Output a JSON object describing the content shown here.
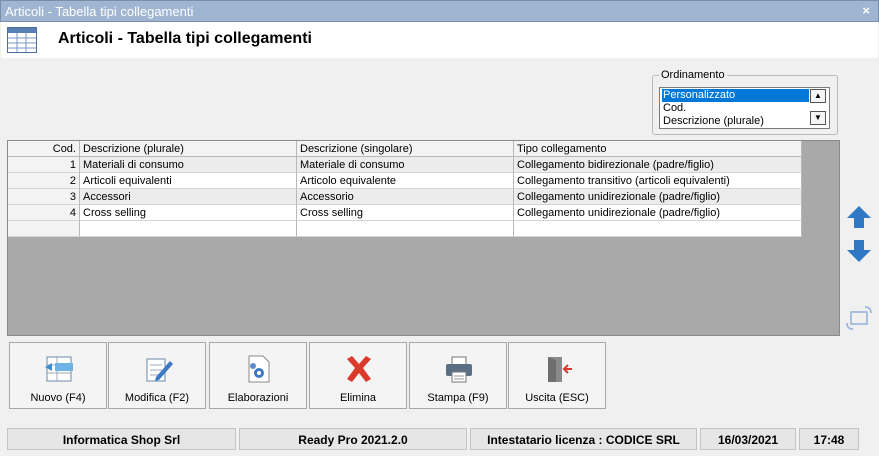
{
  "window": {
    "title": "Articoli - Tabella tipi collegamenti",
    "close_glyph": "×"
  },
  "header": {
    "title": "Articoli - Tabella tipi collegamenti",
    "icon": "table-icon"
  },
  "ordering": {
    "legend": "Ordinamento",
    "options": [
      "Personalizzato",
      "Cod.",
      "Descrizione (plurale)"
    ],
    "selected": "Personalizzato"
  },
  "grid": {
    "columns": [
      "Cod.",
      "Descrizione (plurale)",
      "Descrizione (singolare)",
      "Tipo collegamento"
    ],
    "rows": [
      [
        "1",
        "Materiali di consumo",
        "Materiale di consumo",
        "Collegamento bidirezionale (padre/figlio)"
      ],
      [
        "2",
        "Articoli equivalenti",
        "Articolo equivalente",
        "Collegamento transitivo (articoli equivalenti)"
      ],
      [
        "3",
        "Accessori",
        "Accessorio",
        "Collegamento unidirezionale (padre/figlio)"
      ],
      [
        "4",
        "Cross selling",
        "Cross selling",
        "Collegamento unidirezionale (padre/figlio)"
      ]
    ]
  },
  "side_buttons": {
    "up": "arrow-up-icon",
    "down": "arrow-down-icon",
    "third": "reorder-icon"
  },
  "toolbar": {
    "new": "Nuovo (F4)",
    "edit": "Modifica (F2)",
    "process": "Elaborazioni",
    "delete": "Elimina",
    "print": "Stampa (F9)",
    "exit": "Uscita (ESC)"
  },
  "status": {
    "company": "Informatica Shop Srl",
    "version": "Ready Pro 2021.2.0",
    "license": "Intestatario licenza : CODICE SRL",
    "date": "16/03/2021",
    "time": "17:48"
  },
  "colors": {
    "accent": "#0078d7",
    "titlebar": "#9fb5d2",
    "arrow_blue": "#2f78c4",
    "delete_red": "#d93a2b"
  }
}
